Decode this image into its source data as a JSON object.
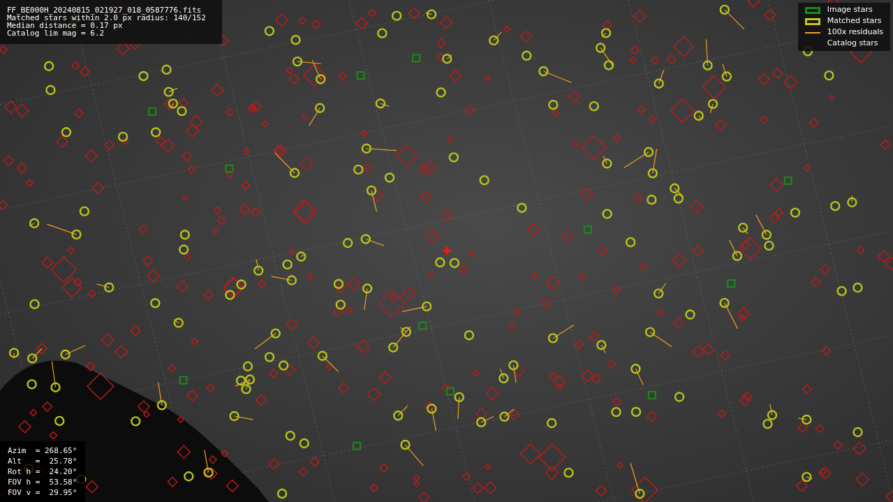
{
  "info": {
    "lines": [
      "FF_BE000H_20240815_021927_018_0587776.fits",
      "Matched stars within 2.0 px radius: 140/152",
      "Median distance = 0.17 px",
      "Catalog lim mag = 6.2"
    ]
  },
  "legend": [
    {
      "kind": "image",
      "label": "Image stars"
    },
    {
      "kind": "matched",
      "label": "Matched stars"
    },
    {
      "kind": "residual",
      "label": "100x residuals"
    },
    {
      "kind": "catalog",
      "label": "Catalog stars"
    }
  ],
  "pointing": {
    "lines": [
      "Azim  = 268.65°",
      "Alt   =  25.78°",
      "Rot h =  24.20°",
      "FOV h =  53.58°",
      "FOV v =  29.95°"
    ]
  }
}
